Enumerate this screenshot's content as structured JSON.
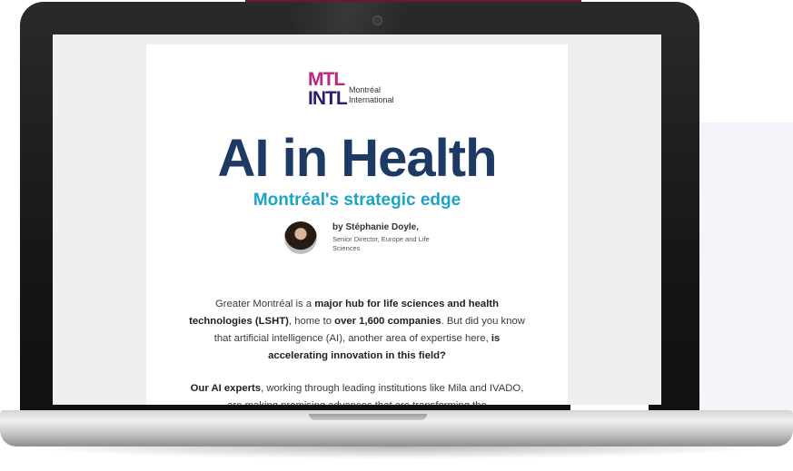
{
  "newsletter": {
    "logo": {
      "mark_line1": "MTL",
      "mark_line2": "INTL",
      "name_line1": "Montréal",
      "name_line2": "International"
    },
    "headline": "AI in Health",
    "subhead": "Montréal's strategic edge",
    "author": {
      "byline": "by Stéphanie Doyle,",
      "role": "Senior Director, Europe and Life Sciences"
    },
    "paragraph1": {
      "t1": "Greater Montréal is a ",
      "b1": "major hub for life sciences and health technologies (LSHT)",
      "t2": ", home to ",
      "b2": "over 1,600 companies",
      "t3": ". But did you know that artificial intelligence (AI), another area of expertise here, ",
      "b3": "is accelerating innovation in this field?"
    },
    "paragraph2": {
      "b1": "Our AI experts",
      "t1": ", working through leading institutions like Mila and IVADO, are making promising advances that are transforming the"
    }
  },
  "colors": {
    "headline": "#1c3a63",
    "subhead": "#1da3c4",
    "logo_pink": "#c0267a",
    "logo_navy": "#2a1f6e"
  }
}
